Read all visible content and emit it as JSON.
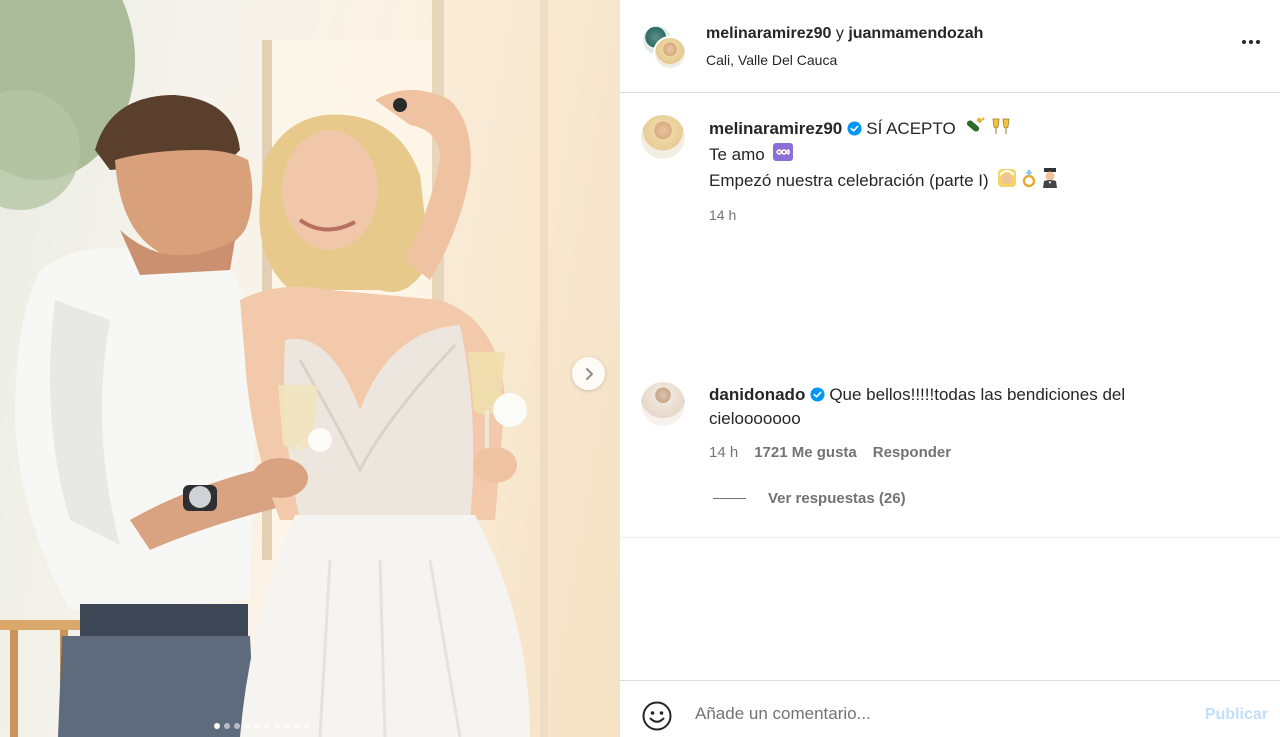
{
  "post": {
    "carousel": {
      "slide_count": 10,
      "active_index": 0
    },
    "header": {
      "user1": "melinaramirez90",
      "conjunction": "y",
      "user2": "juanmamendozah",
      "location": "Cali, Valle Del Cauca"
    },
    "caption": {
      "username": "melinaramirez90",
      "line1": "SÍ ACEPTO",
      "line1_emojis": [
        "champagne-emoji",
        "toasting-glasses-emoji"
      ],
      "line2": "Te amo",
      "line2_emojis": [
        "infinity-emoji"
      ],
      "line3": "Empezó nuestra celebración (parte I)",
      "line3_emojis": [
        "bride-emoji",
        "ring-emoji",
        "groom-emoji"
      ],
      "time": "14 h"
    },
    "comment": {
      "username": "danidonado",
      "text": "Que bellos!!!!!todas las bendiciones del cielooooooo",
      "time": "14 h",
      "likes": "1721 Me gusta",
      "reply": "Responder",
      "view_replies": "Ver respuestas (26)"
    },
    "composer": {
      "placeholder": "Añade un comentario...",
      "publish": "Publicar"
    }
  }
}
